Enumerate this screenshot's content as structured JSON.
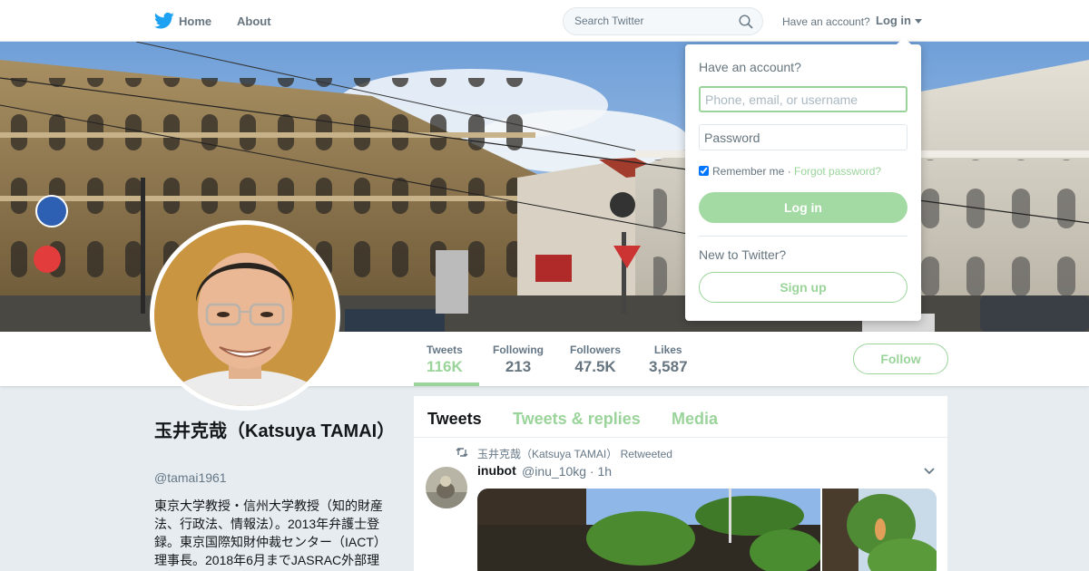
{
  "nav": {
    "home_label": "Home",
    "about_label": "About",
    "search_placeholder": "Search Twitter",
    "have_account": "Have an account?",
    "login_label": "Log in"
  },
  "profile": {
    "name": "玉井克哉（Katsuya TAMAI）",
    "screen_name": "@tamai1961",
    "bio": "東京大学教授・信州大学教授（知的財産法、行政法、情報法）。2013年弁護士登録。東京国際知財仲裁センター（IACT）理事長。2018年6月までJASRAC外部理",
    "follow_label": "Follow",
    "stats": [
      {
        "label": "Tweets",
        "value": "116K"
      },
      {
        "label": "Following",
        "value": "213"
      },
      {
        "label": "Followers",
        "value": "47.5K"
      },
      {
        "label": "Likes",
        "value": "3,587"
      }
    ]
  },
  "timeline": {
    "tabs": [
      "Tweets",
      "Tweets & replies",
      "Media"
    ],
    "tweet": {
      "retweet_text": "玉井克哉（Katsuya TAMAI） Retweeted",
      "author_name": "inubot",
      "author_handle": "@inu_10kg · 1h"
    }
  },
  "login_dropdown": {
    "title": "Have an account?",
    "username_placeholder": "Phone, email, or username",
    "password_placeholder": "Password",
    "remember_me": "Remember me",
    "separator": " · ",
    "forgot_password": "Forgot password?",
    "login_button": "Log in",
    "new_to_twitter": "New to Twitter?",
    "signup_button": "Sign up"
  },
  "colors": {
    "accent": "#9ad49a",
    "text_primary": "#14171a",
    "text_secondary": "#657786",
    "background": "#e6ecf0",
    "twitter_blue": "#1da1f2"
  },
  "icons": [
    "twitter-bird-icon",
    "search-icon",
    "caret-down-icon",
    "retweet-icon",
    "chevron-down-icon"
  ]
}
